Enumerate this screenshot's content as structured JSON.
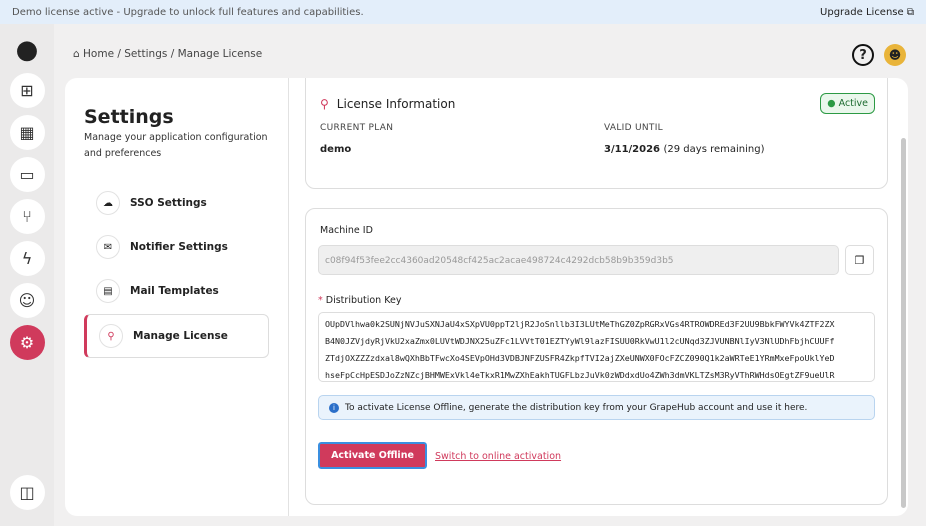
{
  "banner": {
    "text": "Demo license active - Upgrade to unlock full features and capabilities.",
    "upgrade": "Upgrade License"
  },
  "breadcrumb": {
    "home": "Home",
    "settings": "Settings",
    "current": "Manage License",
    "sep": "/"
  },
  "settings": {
    "title": "Settings",
    "subtitle": "Manage your application configuration and preferences",
    "items": [
      {
        "label": "SSO Settings"
      },
      {
        "label": "Notifier Settings"
      },
      {
        "label": "Mail Templates"
      },
      {
        "label": "Manage License"
      }
    ]
  },
  "license": {
    "title": "License Information",
    "status": "Active",
    "current_plan_label": "CURRENT PLAN",
    "current_plan": "demo",
    "valid_until_label": "VALID UNTIL",
    "valid_until": "3/11/2026",
    "remaining": "(29 days remaining)"
  },
  "activation": {
    "machine_id_label": "Machine ID",
    "machine_id": "c08f94f53fee2cc4360ad20548cf425ac2acae498724c4292dcb58b9b359d3b5",
    "dist_key_label": "Distribution Key",
    "dist_key_lines": [
      "OUpDVlhwa0k2SUNjNVJuSXNJaU4xSXpVU0ppT2ljR2JoSnllb3I3LUtMeThGZ0ZpRGRxVGs4RTROWDREd3F2UU9BbkFWYVk4ZTF2ZX",
      "B4N0JZVjdyRjVkU2xaZmx0LUVtWDJNX25uZFc1LVVtT01EZTYyWl9lazFISUU0RkVwU1l2cUNqd3ZJVUNBNlIyV3NlUDhFbjhCUUFf",
      "ZTdjOXZZZzdxal8wQXhBbTFwcXo4SEVpOHd3VDBJNFZUSFR4ZkpfTVI2ajZXeUNWX0FOcFZCZ090Q1k2aWRTeE1YRmMxeFpoUklYeD",
      "hseFpCcHpESDJoZzNZcjBHMWExVkl4eTkxR1MwZXhEakhTUGFLbzJuVk0zWDdxdUo4ZWh3dmVKLTZsM3RyVThRWHdsOEgtZF9ueUlR"
    ],
    "info": "To activate License Offline, generate the distribution key from your GrapeHub account and use it here.",
    "activate": "Activate Offline",
    "switch": "Switch to online activation"
  }
}
